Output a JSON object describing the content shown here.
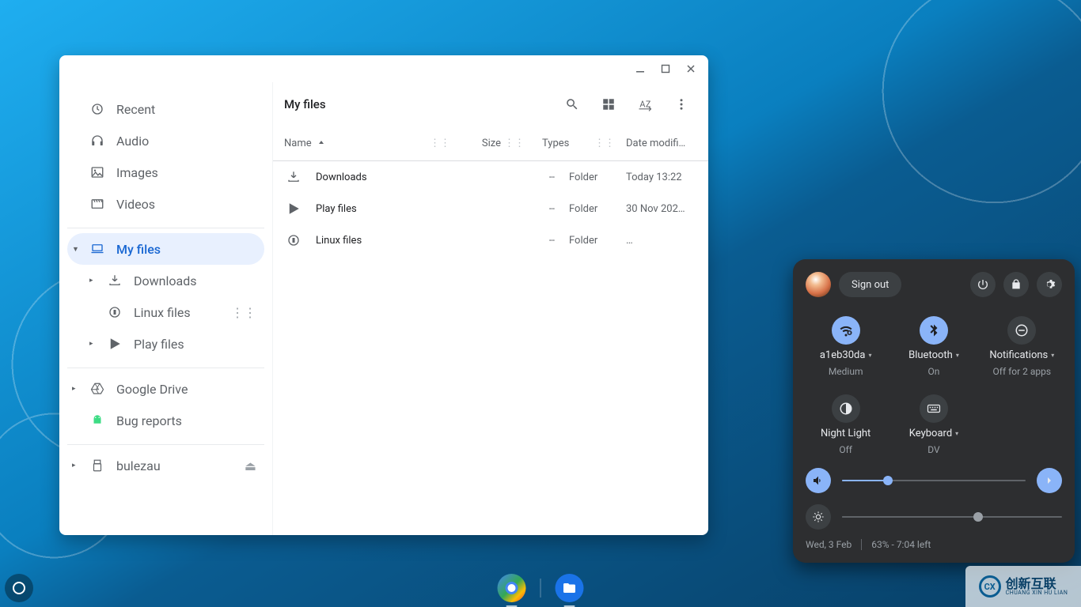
{
  "window": {
    "sidebar": {
      "sections": [
        {
          "items": [
            {
              "key": "recent",
              "label": "Recent",
              "icon": "clock"
            },
            {
              "key": "audio",
              "label": "Audio",
              "icon": "headphones"
            },
            {
              "key": "images",
              "label": "Images",
              "icon": "image"
            },
            {
              "key": "videos",
              "label": "Videos",
              "icon": "movie"
            }
          ]
        },
        {
          "items": [
            {
              "key": "myfiles",
              "label": "My files",
              "icon": "laptop",
              "active": true,
              "caret": "▼"
            },
            {
              "key": "downloads",
              "label": "Downloads",
              "icon": "download",
              "child": true,
              "caret": "▸"
            },
            {
              "key": "linux",
              "label": "Linux files",
              "icon": "linux",
              "child": true,
              "trail": "⋮⋮"
            },
            {
              "key": "play",
              "label": "Play files",
              "icon": "play",
              "child": true,
              "caret": "▸"
            }
          ]
        },
        {
          "items": [
            {
              "key": "gdrive",
              "label": "Google Drive",
              "icon": "drive",
              "caret": "▸"
            },
            {
              "key": "bugs",
              "label": "Bug reports",
              "icon": "android"
            }
          ]
        },
        {
          "items": [
            {
              "key": "bulezau",
              "label": "bulezau",
              "icon": "usb",
              "caret": "▸",
              "trail": "⏏"
            }
          ]
        }
      ]
    },
    "toolbar": {
      "title": "My files"
    },
    "columns": {
      "name": "Name",
      "size": "Size",
      "types": "Types",
      "date": "Date modifi…"
    },
    "rows": [
      {
        "icon": "download",
        "name": "Downloads",
        "size": "--",
        "type": "Folder",
        "date": "Today 13:22"
      },
      {
        "icon": "play",
        "name": "Play files",
        "size": "--",
        "type": "Folder",
        "date": "30 Nov 202…"
      },
      {
        "icon": "linux",
        "name": "Linux files",
        "size": "--",
        "type": "Folder",
        "date": "…"
      }
    ]
  },
  "quickSettings": {
    "signOut": "Sign out",
    "tiles": [
      {
        "key": "wifi",
        "label": "a1eb30da",
        "sub": "Medium",
        "on": true,
        "dropdown": true,
        "icon": "wifi"
      },
      {
        "key": "bt",
        "label": "Bluetooth",
        "sub": "On",
        "on": true,
        "dropdown": true,
        "icon": "bluetooth"
      },
      {
        "key": "notif",
        "label": "Notifications",
        "sub": "Off for 2 apps",
        "on": false,
        "dropdown": true,
        "icon": "dnd"
      },
      {
        "key": "night",
        "label": "Night Light",
        "sub": "Off",
        "on": false,
        "dropdown": false,
        "icon": "contrast"
      },
      {
        "key": "kbd",
        "label": "Keyboard",
        "sub": "DV",
        "on": false,
        "dropdown": true,
        "icon": "keyboard"
      }
    ],
    "volume": 25,
    "brightness": 62,
    "date": "Wed, 3 Feb",
    "battery": "63% - 7:04 left"
  },
  "watermark": {
    "brand": "创新互联",
    "tag": "CHUANG XIN HU LIAN"
  }
}
